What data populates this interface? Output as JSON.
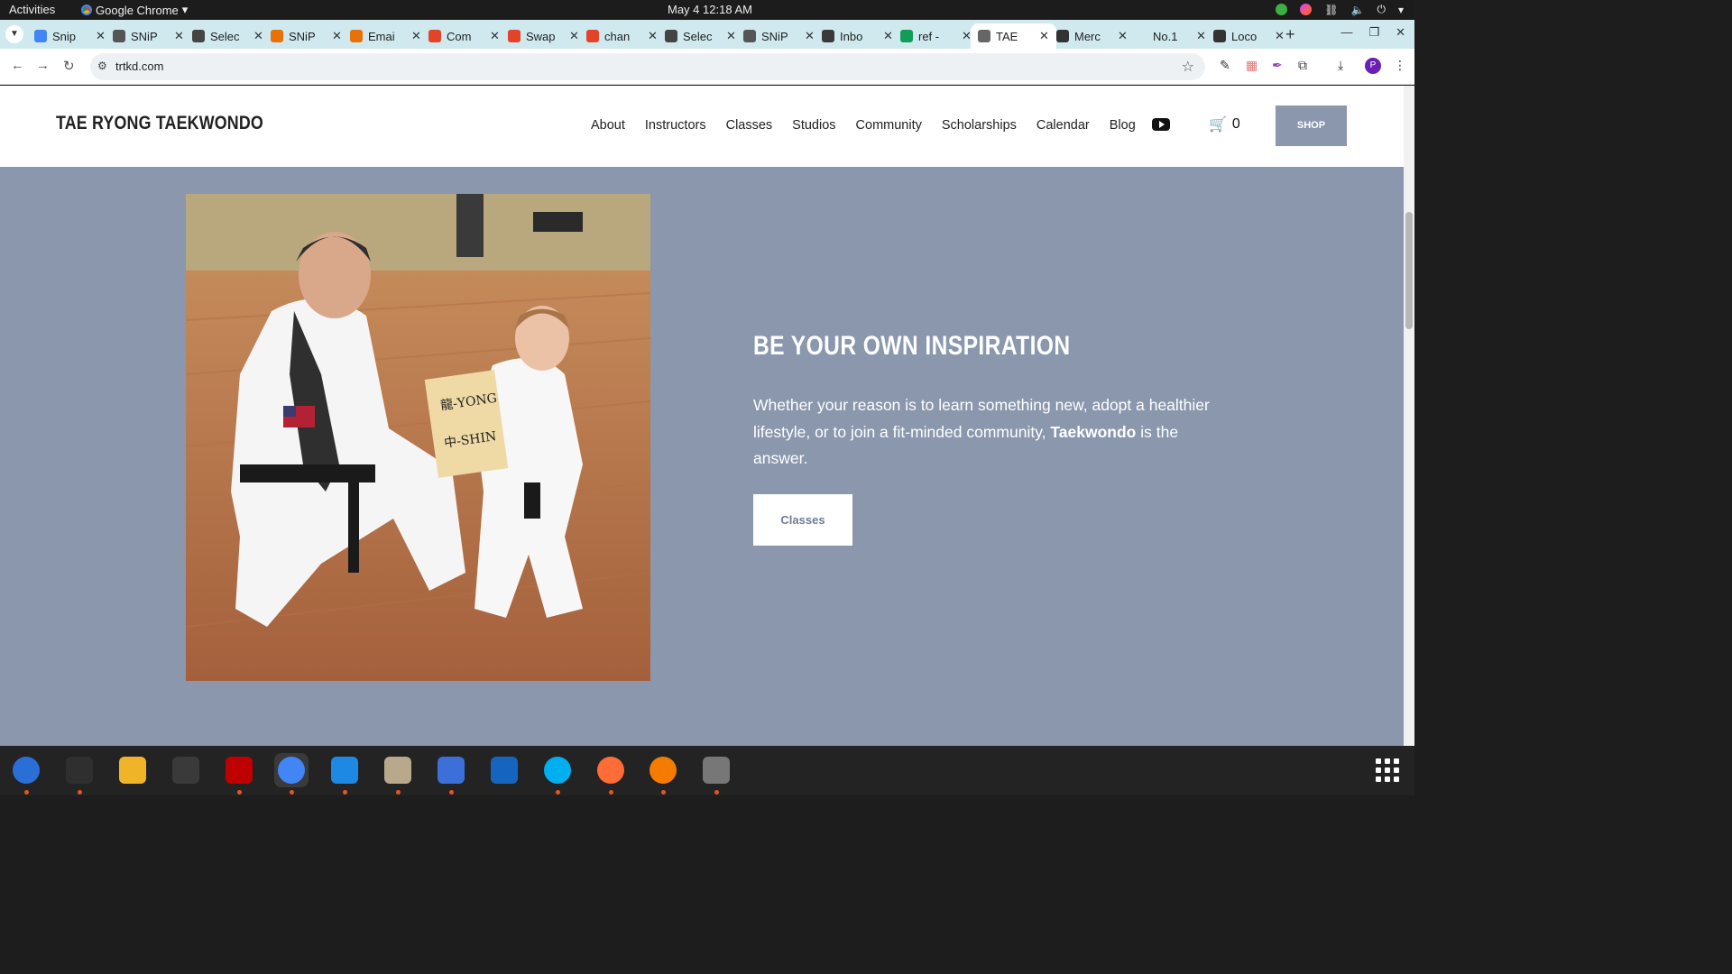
{
  "system": {
    "activities": "Activities",
    "app_menu": "Google Chrome",
    "clock": "May 4  12:18 AM"
  },
  "browser": {
    "tabs": [
      {
        "label": "Snip",
        "icon_color": "#4285f4"
      },
      {
        "label": "SNiP",
        "icon_color": "#555555"
      },
      {
        "label": "Selec",
        "icon_color": "#444444"
      },
      {
        "label": "SNiP",
        "icon_color": "#e8710a"
      },
      {
        "label": "Emai",
        "icon_color": "#e8710a"
      },
      {
        "label": "Com",
        "icon_color": "#e24329"
      },
      {
        "label": "Swap",
        "icon_color": "#e24329"
      },
      {
        "label": "chan",
        "icon_color": "#e24329"
      },
      {
        "label": "Selec",
        "icon_color": "#444444"
      },
      {
        "label": "SNiP",
        "icon_color": "#555555"
      },
      {
        "label": "Inbo",
        "icon_color": "#3a3a3a"
      },
      {
        "label": "ref -",
        "icon_color": "#0f9d58"
      },
      {
        "label": "TAE",
        "icon_color": "#666666",
        "active": true
      },
      {
        "label": "Merc",
        "icon_color": "#333333"
      },
      {
        "label": "No.1",
        "icon_color": "#cfe9ef"
      },
      {
        "label": "Loco",
        "icon_color": "#333333"
      }
    ],
    "url": "trtkd.com",
    "profile_initial": "P"
  },
  "site": {
    "logo": "TAE RYONG TAEKWONDO",
    "nav": [
      "About",
      "Instructors",
      "Classes",
      "Studios",
      "Community",
      "Scholarships",
      "Calendar",
      "Blog"
    ],
    "cart_count": "0",
    "shop_label": "SHOP",
    "headline": "BE YOUR OWN INSPIRATION",
    "body_before": "Whether your reason is to learn something new, adopt a healthier lifestyle, or to join a fit-minded community, ",
    "body_bold": "Taekwondo",
    "body_after": " is the answer.",
    "cta_label": "Classes",
    "photo_sign_line1": "龍-YONG",
    "photo_sign_line2": "中-SHIN"
  },
  "dock": {
    "apps": [
      "thunderbird-icon",
      "terminal-icon",
      "calculator-icon",
      "system-monitor-icon",
      "filezilla-icon",
      "chrome-icon",
      "vscode-icon",
      "files-icon",
      "text-editor-icon",
      "libreoffice-writer-icon",
      "skype-icon",
      "postman-icon",
      "burn-icon",
      "disk-icon"
    ]
  }
}
